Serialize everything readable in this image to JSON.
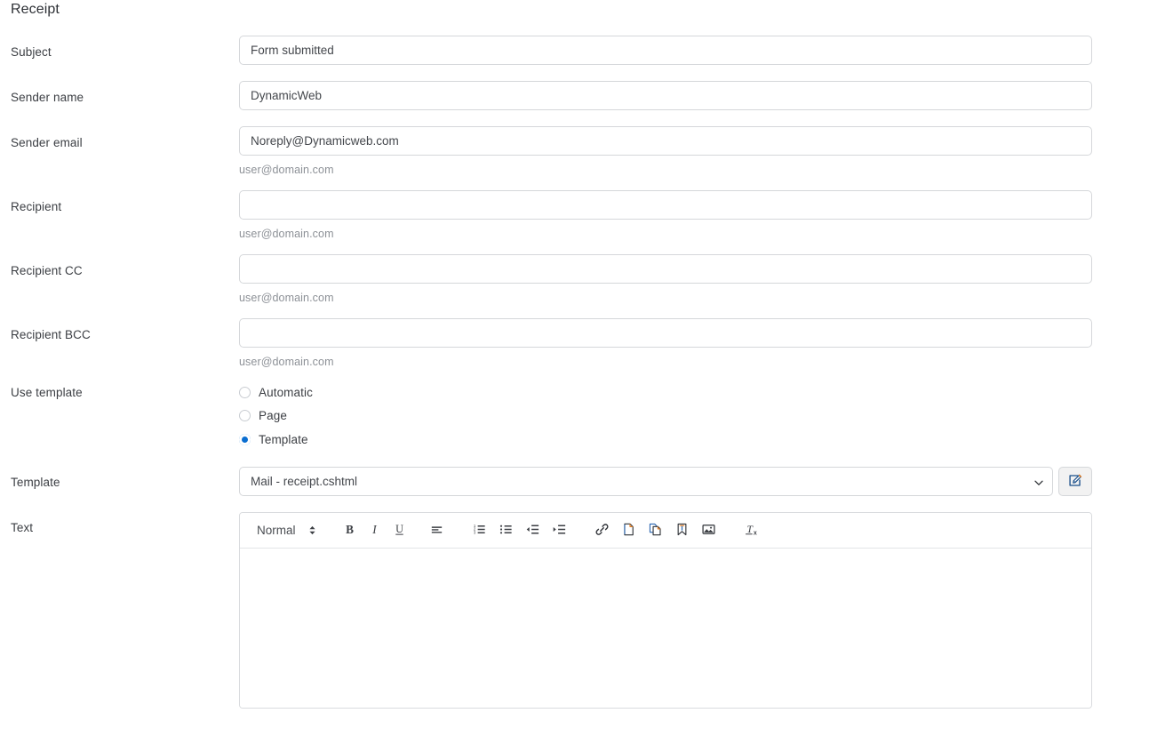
{
  "page": {
    "title": "Receipt"
  },
  "fields": {
    "subject": {
      "label": "Subject",
      "value": "Form submitted",
      "placeholder": ""
    },
    "sender_name": {
      "label": "Sender name",
      "value": "DynamicWeb",
      "placeholder": ""
    },
    "sender_email": {
      "label": "Sender email",
      "value": "Noreply@Dynamicweb.com",
      "placeholder": "",
      "helper": "user@domain.com"
    },
    "recipient": {
      "label": "Recipient",
      "value": "",
      "placeholder": "",
      "helper": "user@domain.com"
    },
    "recipient_cc": {
      "label": "Recipient CC",
      "value": "",
      "placeholder": "",
      "helper": "user@domain.com"
    },
    "recipient_bcc": {
      "label": "Recipient BCC",
      "value": "",
      "placeholder": "",
      "helper": "user@domain.com"
    },
    "use_template": {
      "label": "Use template",
      "options": [
        {
          "label": "Automatic",
          "checked": false
        },
        {
          "label": "Page",
          "checked": false
        },
        {
          "label": "Template",
          "checked": true
        }
      ]
    },
    "template": {
      "label": "Template",
      "value": "Mail - receipt.cshtml",
      "edit_button_icon": "edit-pencil-icon"
    },
    "text": {
      "label": "Text",
      "value": ""
    }
  },
  "editor": {
    "style_select": {
      "value": "Normal",
      "icon": "stepper-updown-icon"
    },
    "buttons": [
      {
        "name": "bold-button",
        "icon": "bold-icon",
        "label": "B"
      },
      {
        "name": "italic-button",
        "icon": "italic-icon",
        "label": "I"
      },
      {
        "name": "underline-button",
        "icon": "underline-icon",
        "label": "U"
      },
      {
        "name": "align-left-button",
        "icon": "align-left-icon",
        "label": ""
      },
      {
        "name": "ordered-list-button",
        "icon": "ordered-list-icon",
        "label": ""
      },
      {
        "name": "bullet-list-button",
        "icon": "bullet-list-icon",
        "label": ""
      },
      {
        "name": "outdent-button",
        "icon": "outdent-icon",
        "label": ""
      },
      {
        "name": "indent-button",
        "icon": "indent-icon",
        "label": ""
      },
      {
        "name": "insert-link-button",
        "icon": "link-icon",
        "label": ""
      },
      {
        "name": "insert-file-button",
        "icon": "file-icon",
        "label": ""
      },
      {
        "name": "paste-button",
        "icon": "paste-icon",
        "label": ""
      },
      {
        "name": "bookmark-button",
        "icon": "bookmark-icon",
        "label": ""
      },
      {
        "name": "insert-image-button",
        "icon": "image-icon",
        "label": ""
      },
      {
        "name": "clear-formatting-button",
        "icon": "remove-format-icon",
        "label": ""
      }
    ]
  },
  "colors": {
    "accent": "#0a6ed1",
    "border": "#d5d7da",
    "text": "#3b3e43",
    "helper_text": "#8d9197",
    "button_bg": "#f2f2f2"
  }
}
